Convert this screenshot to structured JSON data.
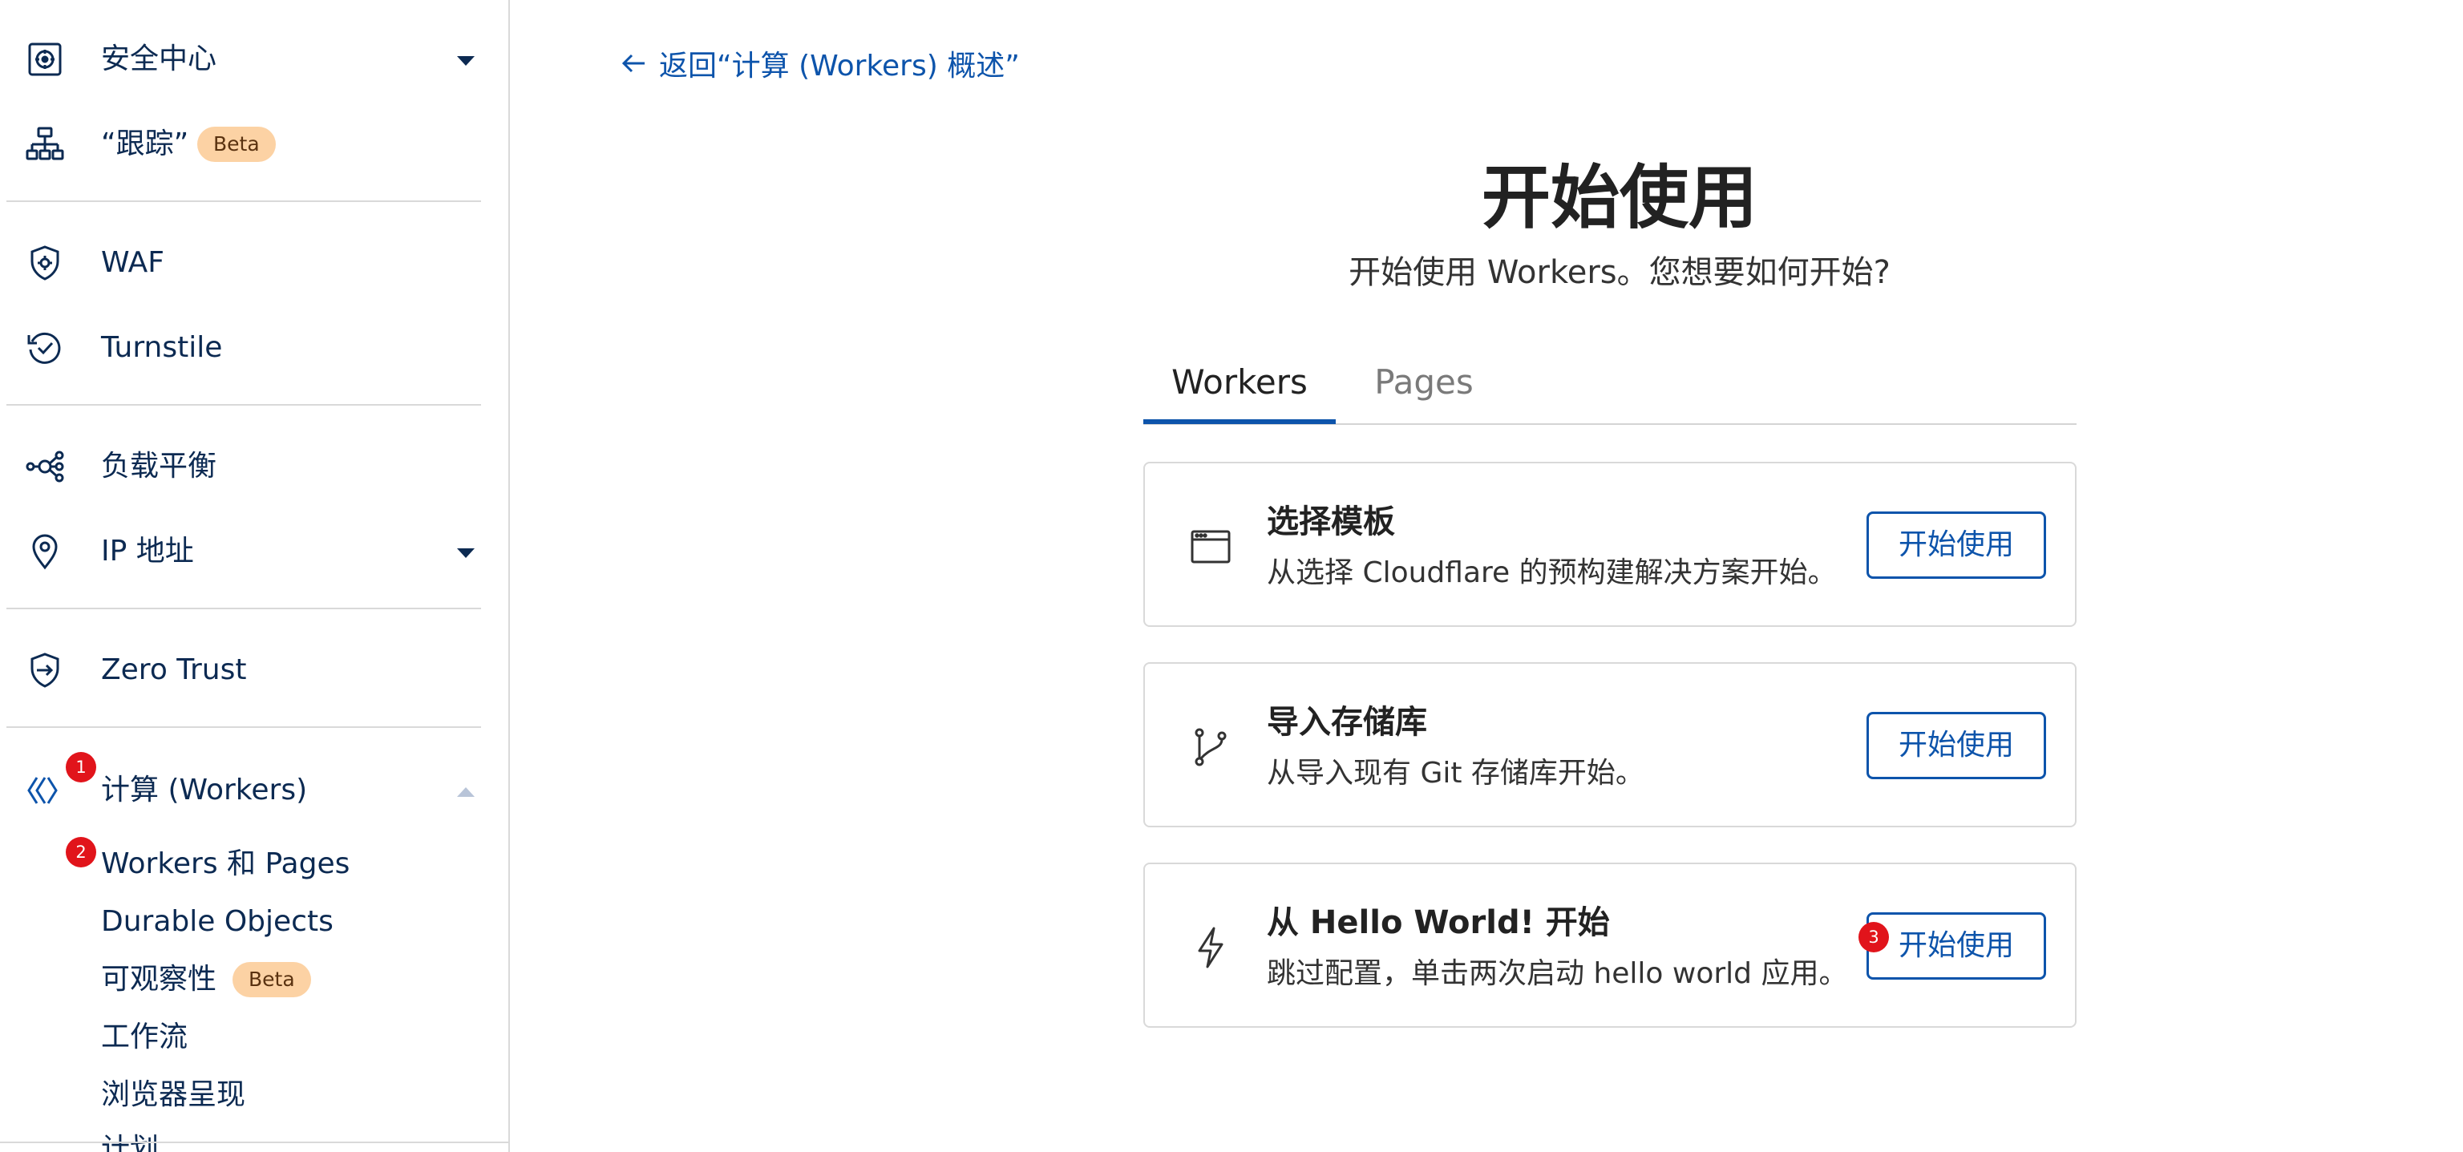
{
  "sidebar": {
    "items": [
      {
        "label": "安全中心",
        "icon": "security-center-icon",
        "has_caret": true
      },
      {
        "label": "“跟踪”",
        "icon": "trace-icon",
        "badge": "Beta"
      },
      {
        "label": "WAF",
        "icon": "waf-shield-gear-icon"
      },
      {
        "label": "Turnstile",
        "icon": "turnstile-icon"
      },
      {
        "label": "负载平衡",
        "icon": "load-balancing-icon"
      },
      {
        "label": "IP 地址",
        "icon": "location-pin-icon",
        "has_caret": true
      },
      {
        "label": "Zero Trust",
        "icon": "zero-trust-shield-icon"
      },
      {
        "label": "计算 (Workers)",
        "icon": "workers-icon",
        "expanded": true,
        "step_marker": "1"
      }
    ],
    "sub_items": [
      {
        "label": "Workers 和 Pages",
        "step_marker": "2"
      },
      {
        "label": "Durable Objects"
      },
      {
        "label": "可观察性",
        "badge": "Beta"
      },
      {
        "label": "工作流"
      },
      {
        "label": "浏览器呈现"
      },
      {
        "label": "计划"
      }
    ]
  },
  "main": {
    "back_link": "返回“计算 (Workers) 概述”",
    "title": "开始使用",
    "subtitle": "开始使用 Workers。您想要如何开始?",
    "tabs": [
      {
        "label": "Workers",
        "active": true
      },
      {
        "label": "Pages",
        "active": false
      }
    ],
    "cards": [
      {
        "title": "选择模板",
        "description": "从选择 Cloudflare 的预构建解决方案开始。",
        "button": "开始使用",
        "icon": "browser-window-icon"
      },
      {
        "title": "导入存储库",
        "description": "从导入现有 Git 存储库开始。",
        "button": "开始使用",
        "icon": "git-branch-icon"
      },
      {
        "title": "从 Hello World! 开始",
        "description": "跳过配置，单击两次启动 hello world 应用。",
        "button": "开始使用",
        "icon": "lightning-bolt-icon",
        "step_marker": "3"
      }
    ]
  },
  "colors": {
    "accent": "#0d54ab",
    "nav_text": "#0c2a52",
    "badge_bg": "#fcd2a4",
    "step_marker": "#e1141b",
    "border": "#d9d9d9"
  }
}
